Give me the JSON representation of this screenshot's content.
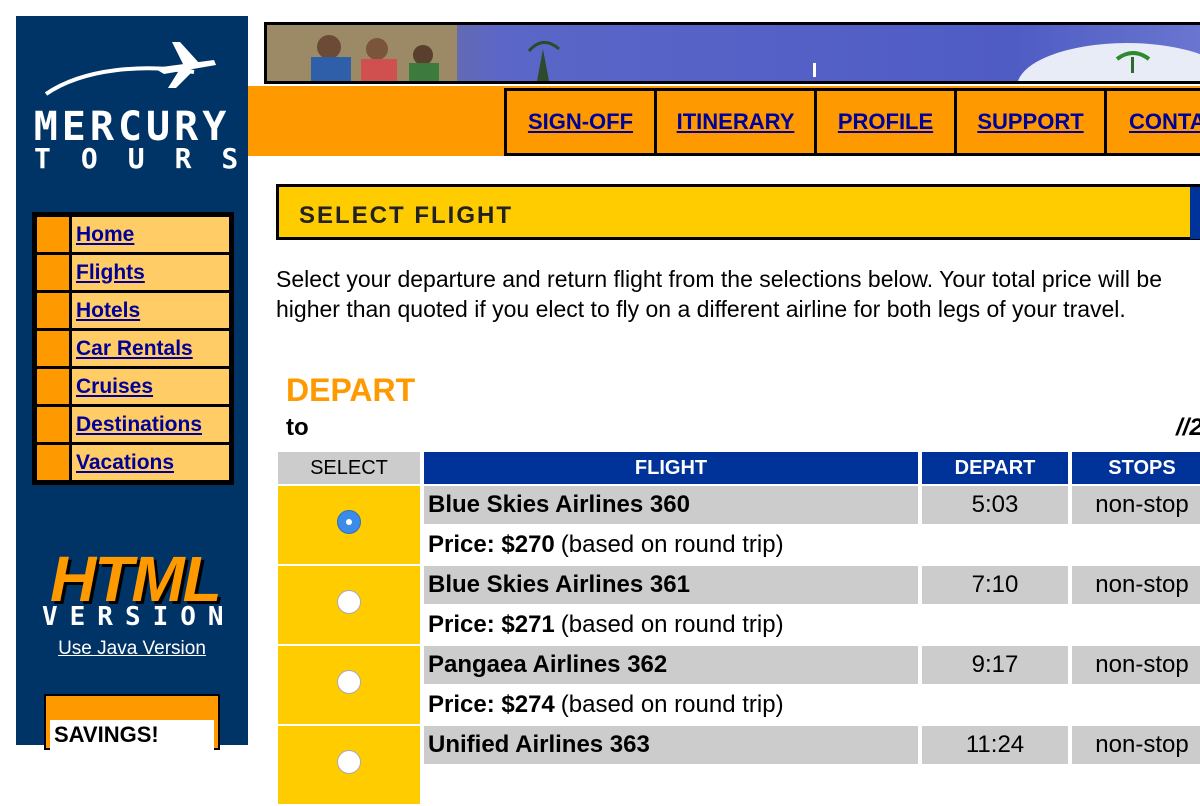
{
  "brand": {
    "line1": "MERCURY",
    "line2": "TOURS"
  },
  "sidebar": {
    "items": [
      {
        "label": "Home"
      },
      {
        "label": "Flights"
      },
      {
        "label": "Hotels"
      },
      {
        "label": "Car Rentals"
      },
      {
        "label": "Cruises"
      },
      {
        "label": "Destinations"
      },
      {
        "label": "Vacations"
      }
    ],
    "badge_html": "HTML",
    "badge_version": "VERSION",
    "java_link": "Use Java Version",
    "savings": "SAVINGS!"
  },
  "topnav": [
    {
      "label": "SIGN-OFF"
    },
    {
      "label": "ITINERARY"
    },
    {
      "label": "PROFILE"
    },
    {
      "label": "SUPPORT"
    },
    {
      "label": "CONTACT"
    }
  ],
  "section_title": "SELECT FLIGHT",
  "intro": "Select your departure and return flight from the selections below. Your total price will be higher than quoted if you elect to fly on a different airline for both legs of your travel.",
  "depart": {
    "title": "DEPART",
    "route": "to",
    "date": "//2",
    "columns": {
      "select": "SELECT",
      "flight": "FLIGHT",
      "depart": "DEPART",
      "stops": "STOPS"
    },
    "flights": [
      {
        "name": "Blue Skies Airlines 360",
        "time": "5:03",
        "stops": "non-stop",
        "price_label": "Price: $270",
        "price_note": "(based on round trip)",
        "selected": true
      },
      {
        "name": "Blue Skies Airlines 361",
        "time": "7:10",
        "stops": "non-stop",
        "price_label": "Price: $271",
        "price_note": "(based on round trip)",
        "selected": false
      },
      {
        "name": "Pangaea Airlines 362",
        "time": "9:17",
        "stops": "non-stop",
        "price_label": "Price: $274",
        "price_note": "(based on round trip)",
        "selected": false
      },
      {
        "name": "Unified Airlines 363",
        "time": "11:24",
        "stops": "non-stop",
        "price_label": "",
        "price_note": "",
        "selected": false
      }
    ]
  },
  "colors": {
    "navy": "#003366",
    "orange": "#ff9900",
    "yellow": "#ffcc00",
    "table_blue": "#003399",
    "link": "#000099"
  }
}
